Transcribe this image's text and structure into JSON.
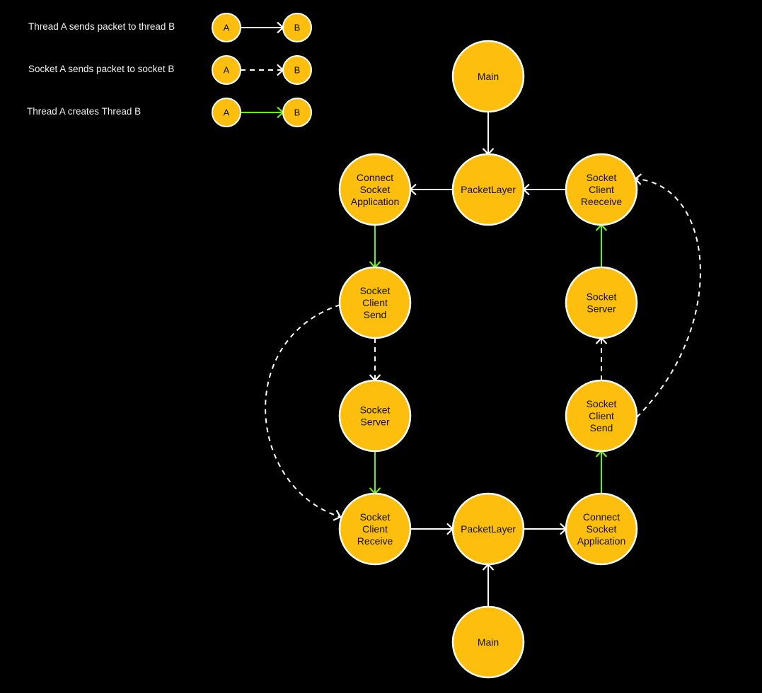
{
  "colors": {
    "background": "#000000",
    "node_fill": "#fdbe0d",
    "node_stroke": "#ffffff",
    "edge_thread": "#ffffff",
    "edge_socket": "#ffffff",
    "edge_create": "#66f20a"
  },
  "legend": [
    {
      "label": "Thread A sends packet to thread B",
      "kind": "thread",
      "from": "A",
      "to": "B"
    },
    {
      "label": "Socket A sends packet to socket B",
      "kind": "socket",
      "from": "A",
      "to": "B"
    },
    {
      "label": "Thread A creates Thread B",
      "kind": "create",
      "from": "A",
      "to": "B"
    }
  ],
  "nodes": [
    {
      "id": "main_top",
      "lines": [
        "Main"
      ]
    },
    {
      "id": "packet_top",
      "lines": [
        "PacketLayer"
      ]
    },
    {
      "id": "csa_top",
      "lines": [
        "Connect",
        "Socket",
        "Application"
      ]
    },
    {
      "id": "scr_right",
      "lines": [
        "Socket",
        "Client",
        "Reeceive"
      ]
    },
    {
      "id": "scs_left",
      "lines": [
        "Socket",
        "Client",
        "Send"
      ]
    },
    {
      "id": "ss_right",
      "lines": [
        "Socket",
        "Server"
      ]
    },
    {
      "id": "ss_left",
      "lines": [
        "Socket",
        "Server"
      ]
    },
    {
      "id": "scs_right",
      "lines": [
        "Socket",
        "Client",
        "Send"
      ]
    },
    {
      "id": "scr_left",
      "lines": [
        "Socket",
        "Client",
        "Receive"
      ]
    },
    {
      "id": "packet_bottom",
      "lines": [
        "PacketLayer"
      ]
    },
    {
      "id": "csa_bottom",
      "lines": [
        "Connect",
        "Socket",
        "Application"
      ]
    },
    {
      "id": "main_bottom",
      "lines": [
        "Main"
      ]
    }
  ],
  "edges": [
    {
      "from": "main_top",
      "to": "packet_top",
      "kind": "thread"
    },
    {
      "from": "packet_top",
      "to": "csa_top",
      "kind": "thread"
    },
    {
      "from": "scr_right",
      "to": "packet_top",
      "kind": "thread"
    },
    {
      "from": "csa_top",
      "to": "scs_left",
      "kind": "create"
    },
    {
      "from": "scs_left",
      "to": "ss_left",
      "kind": "socket"
    },
    {
      "from": "scs_left",
      "to": "scr_left",
      "kind": "socket"
    },
    {
      "from": "ss_left",
      "to": "scr_left",
      "kind": "create"
    },
    {
      "from": "scr_left",
      "to": "packet_bottom",
      "kind": "thread"
    },
    {
      "from": "packet_bottom",
      "to": "csa_bottom",
      "kind": "thread"
    },
    {
      "from": "main_bottom",
      "to": "packet_bottom",
      "kind": "thread"
    },
    {
      "from": "csa_bottom",
      "to": "scs_right",
      "kind": "create"
    },
    {
      "from": "scs_right",
      "to": "ss_right",
      "kind": "socket"
    },
    {
      "from": "scs_right",
      "to": "scr_right",
      "kind": "socket"
    },
    {
      "from": "ss_right",
      "to": "scr_right",
      "kind": "create"
    }
  ]
}
